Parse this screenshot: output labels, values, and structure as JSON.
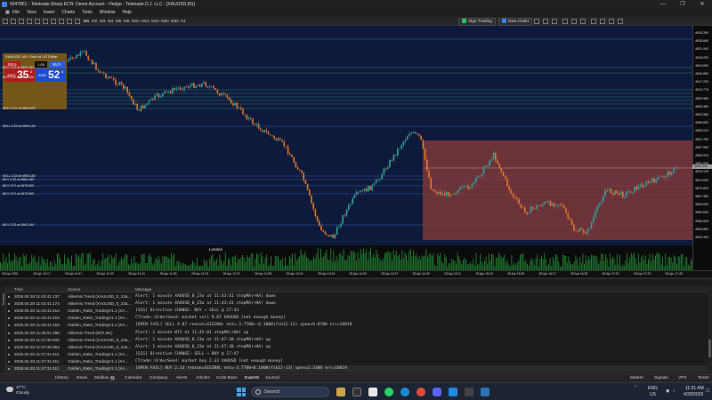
{
  "window": {
    "title": "5047861 - Teletrade-Sharp ECN: Demo Account - Hedge - Teletrade D.J. LLC - [XAUUSD,M1]",
    "controls": [
      "—",
      "❐",
      "✕"
    ]
  },
  "menu": [
    "File",
    "View",
    "Insert",
    "Charts",
    "Tools",
    "Window",
    "Help"
  ],
  "toolbar": {
    "timeframes": [
      "M1",
      "M2",
      "M3",
      "M4",
      "M5",
      "M6",
      "M10",
      "M12",
      "M15",
      "M20",
      "M30",
      "H1"
    ],
    "algo_trading": "Algo Trading",
    "new_order": "New Order"
  },
  "chart": {
    "symbol_line": "XAUUSD, M1:  Gold vs US Dollar",
    "tabs": [
      "XAUUSD_0_23a,M1",
      "XAUUSD_0_23a,M1",
      "XAUUSD,M1",
      "WTI,M1",
      "DX,M5"
    ],
    "session_label": "London",
    "panel": {
      "sell": "SELL",
      "buy": "BUY",
      "lot": "1.00",
      "bid_small": "4583",
      "bid_big": "35",
      "bid_sup": "0",
      "ask_small": "4583",
      "ask_big": "52",
      "ask_sup": "8"
    },
    "order_labels": [
      "BUY 9.02 at 4620.380",
      "BUY 0.03 at 4617.440",
      "SELL 9.07 at 4605.600",
      "SELL 2.33 at 4599.130",
      "SELL 2.33 at 4590.180",
      "BUY 2.33 at 4582.180",
      "BUY 9.07 at 4576.600",
      "BUY 9.07 at 4573.690",
      "BUY 2.33 at 4562.440"
    ],
    "price_labels": [
      "4639.260",
      "4635.660",
      "4631.940",
      "4628.250",
      "4624.650",
      "4620.890",
      "4617.230",
      "4613.776",
      "4609.980",
      "4606.380",
      "4602.580",
      "4598.830",
      "4595.210",
      "4591.760",
      "4587.990",
      "4583.910",
      "4581.925",
      "4578.125",
      "4574.630",
      "4570.820",
      "4567.380",
      "4563.620",
      "4559.840",
      "4556.825",
      "4553.800",
      "4549.340"
    ],
    "current_price": "4583.352",
    "time_labels": [
      "28 Apr 2026",
      "28 Apr 10:17",
      "28 Apr 10:47",
      "28 Apr 11:09",
      "28 Apr 11:31",
      "28 Apr 11:53",
      "28 Apr 12:15",
      "28 Apr 12:37",
      "28 Apr 12:59",
      "28 Apr 13:21",
      "28 Apr 13:43",
      "28 Apr 14:05",
      "28 Apr 14:27",
      "28 Apr 14:49",
      "28 Apr 15:11",
      "28 Apr 15:33",
      "28 Apr 15:55",
      "28 Apr 16:17",
      "28 Apr 16:39",
      "28 Apr 17:01",
      "28 Apr 17:23",
      "28 Apr 17:45"
    ],
    "colors": {
      "background": "#0e1a3b",
      "bull": "#2fa39b",
      "bear": "#e0782c",
      "zone": "#8c3b3b"
    }
  },
  "log": {
    "columns": {
      "time": "Time",
      "source": "Source",
      "message": "Message"
    },
    "rows": [
      {
        "time": "2026.04.28 11:43:41.137",
        "source": "Alikemix Trend (XAUUSD_0_23a,...",
        "message": "Alert: 1 minute XAUUSD_0_23a at 11:43:41 stepMA(+HA) down"
      },
      {
        "time": "2026.04.28 11:43:41.174",
        "source": "Alikemix Trend (XAUUSD_0_23a,...",
        "message": "Alert: 1 minute XAUUSD_0_23a at 11:43:41 stepMA(+HA) down"
      },
      {
        "time": "2026.04.28 11:43:41.514",
        "source": "Golden_Ratio_TradingV1.1 (XA...",
        "message": "[SIG] Direction CHANGE: BUY → SELL @ 17:43"
      },
      {
        "time": "2026.04.28 11:43:41.515",
        "source": "Golden_Ratio_TradingV1.1 (XA...",
        "message": "CTrade::OrderSend: market sell 9.87 XAUUSD [not enough money]"
      },
      {
        "time": "2026.04.28 11:43:41.515",
        "source": "Golden_Ratio_TradingV1.1 (XA...",
        "message": "[OPEN FAIL] SELL 9.87  reason=SIGINAL net=-3.7700→-6.1000(fib12-13) open=9.8700  err=10019"
      },
      {
        "time": "2026.04.28 11:45:01.390",
        "source": "Alikemix Trend (WTI,M1)",
        "message": "Alert: 1 minute WTI at 11:45:01 stepMA(+HA) up"
      },
      {
        "time": "2026.04.28 11:47:30.932",
        "source": "Alikemix Trend (XAUUSD_0_23a,...",
        "message": "Alert: 1 minute XAUUSD_0_23a at 11:47:30 stepMA(+HA) up"
      },
      {
        "time": "2026.04.28 11:47:30.964",
        "source": "Alikemix Trend (XAUUSD_0_23a,...",
        "message": "Alert: 1 minute XAUUSD_0_23a at 11:47:30 stepMA(+HA) up"
      },
      {
        "time": "2026.04.28 11:47:31.511",
        "source": "Golden_Ratio_TradingV1.1 (XA...",
        "message": "[SIG] Direction CHANGE: SELL → BUY @ 17:47"
      },
      {
        "time": "2026.04.28 11:47:31.511",
        "source": "Golden_Ratio_TradingV1.1 (XA...",
        "message": "CTrade::OrderSend: market buy 2.33 XAUUSD [not enough money]"
      },
      {
        "time": "2026.04.28 11:47:31.511",
        "source": "Golden_Ratio_TradingV1.1 (XA...",
        "message": "[OPEN FAIL] BUY  2.33  reason=SIGINAL net=-3.7700→6.1000(fib12-13) open=2.3300  err=10019"
      }
    ]
  },
  "toolbox_label": "Toolbox",
  "terminal_tabs": [
    "History",
    "News",
    "Mailbox",
    "Calendar",
    "Company",
    "Alerts",
    "Articles",
    "Code Base",
    "Experts",
    "Journal"
  ],
  "mailbox_badge": "11",
  "active_terminal_tab": "Experts",
  "terminal_right": [
    "Market",
    "Signals",
    "VPS",
    "Tester"
  ],
  "taskbar": {
    "temp": "17°C",
    "weather": "Cloudy",
    "search_placeholder": "Search",
    "lang1": "ENG",
    "lang2": "US",
    "time": "11:51 AM",
    "date": "4/28/2026"
  }
}
